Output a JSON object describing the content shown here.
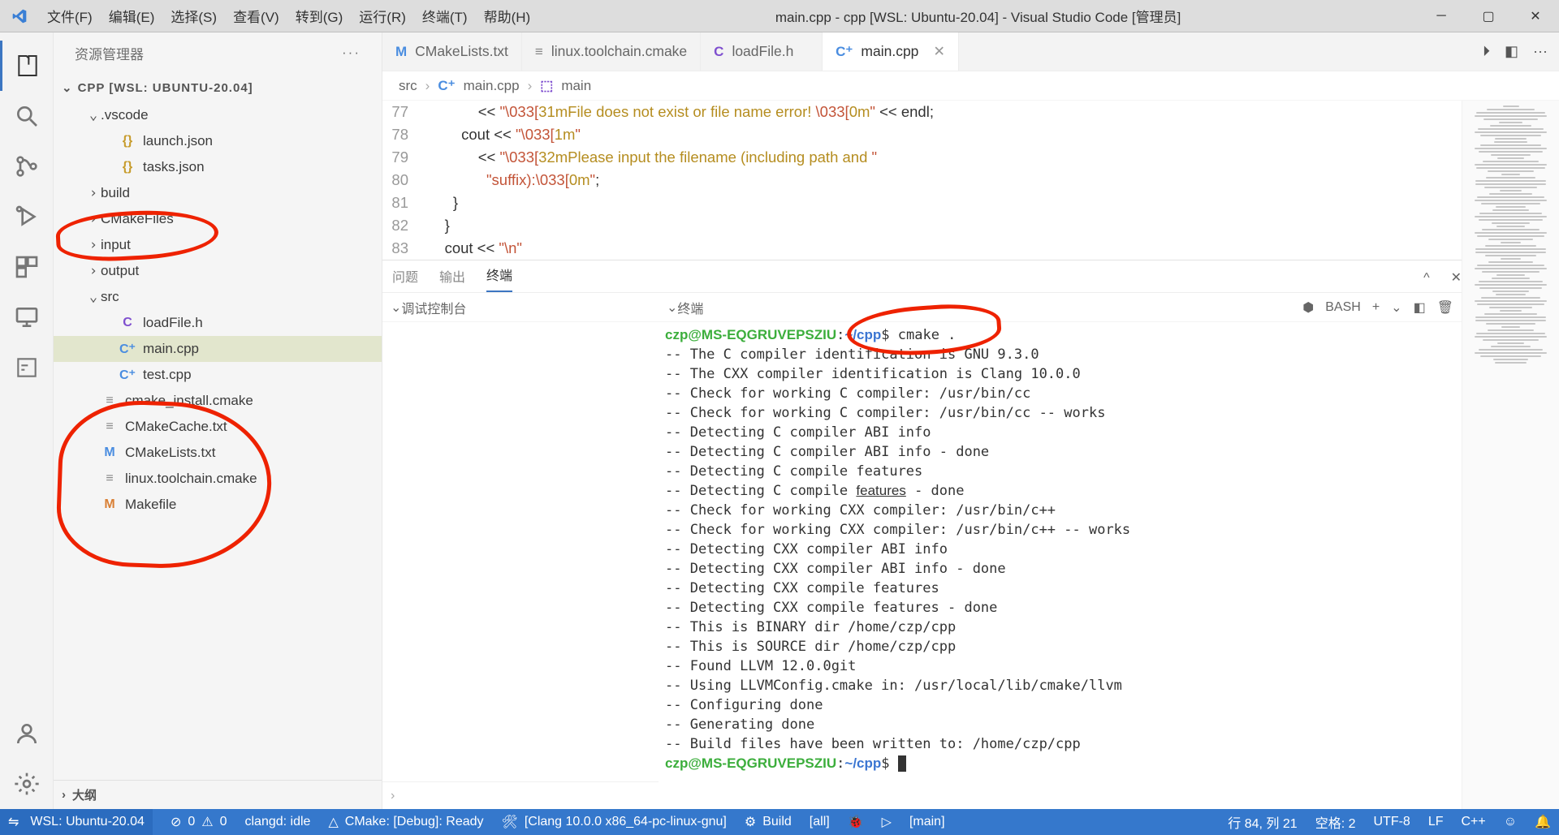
{
  "window": {
    "title": "main.cpp - cpp [WSL: Ubuntu-20.04] - Visual Studio Code [管理员]",
    "menus": [
      "文件(F)",
      "编辑(E)",
      "选择(S)",
      "查看(V)",
      "转到(G)",
      "运行(R)",
      "终端(T)",
      "帮助(H)"
    ]
  },
  "sidebar": {
    "title": "资源管理器",
    "folder_label": "CPP [WSL: UBUNTU-20.04]",
    "tree": [
      {
        "indent": 1,
        "kind": "folder-open",
        "label": ".vscode"
      },
      {
        "indent": 2,
        "kind": "file",
        "icon": "{}",
        "iconcls": "fi-yellow",
        "label": "launch.json"
      },
      {
        "indent": 2,
        "kind": "file",
        "icon": "{}",
        "iconcls": "fi-yellow",
        "label": "tasks.json"
      },
      {
        "indent": 1,
        "kind": "folder-closed",
        "label": "build"
      },
      {
        "indent": 1,
        "kind": "folder-closed",
        "label": "CMakeFiles"
      },
      {
        "indent": 1,
        "kind": "folder-closed",
        "label": "input"
      },
      {
        "indent": 1,
        "kind": "folder-closed",
        "label": "output"
      },
      {
        "indent": 1,
        "kind": "folder-open",
        "label": "src"
      },
      {
        "indent": 2,
        "kind": "file",
        "icon": "C",
        "iconcls": "fi-purple",
        "label": "loadFile.h"
      },
      {
        "indent": 2,
        "kind": "file",
        "icon": "C⁺",
        "iconcls": "fi-blue",
        "label": "main.cpp",
        "selected": true
      },
      {
        "indent": 2,
        "kind": "file",
        "icon": "C⁺",
        "iconcls": "fi-blue",
        "label": "test.cpp"
      },
      {
        "indent": 1,
        "kind": "file",
        "icon": "≡",
        "iconcls": "fi-gray",
        "label": "cmake_install.cmake"
      },
      {
        "indent": 1,
        "kind": "file",
        "icon": "≡",
        "iconcls": "fi-gray",
        "label": "CMakeCache.txt"
      },
      {
        "indent": 1,
        "kind": "file",
        "icon": "M",
        "iconcls": "fi-blue",
        "label": "CMakeLists.txt"
      },
      {
        "indent": 1,
        "kind": "file",
        "icon": "≡",
        "iconcls": "fi-gray",
        "label": "linux.toolchain.cmake"
      },
      {
        "indent": 1,
        "kind": "file",
        "icon": "M",
        "iconcls": "fi-orange",
        "label": "Makefile"
      }
    ],
    "outline": "大纲"
  },
  "tabs": [
    {
      "icon": "M",
      "iconcls": "fi-blue",
      "label": "CMakeLists.txt"
    },
    {
      "icon": "≡",
      "iconcls": "fi-gray",
      "label": "linux.toolchain.cmake"
    },
    {
      "icon": "C",
      "iconcls": "fi-purple",
      "label": "loadFile.h"
    },
    {
      "icon": "C⁺",
      "iconcls": "fi-blue",
      "label": "main.cpp",
      "active": true,
      "close": true
    }
  ],
  "breadcrumbs": {
    "parts": [
      {
        "label": "src"
      },
      {
        "icon": "C⁺",
        "iconcls": "fi-blue",
        "label": "main.cpp"
      },
      {
        "icon": "⬚",
        "iconcls": "fi-purple",
        "label": "main"
      }
    ]
  },
  "code": [
    {
      "n": 77,
      "pre": "            ",
      "segs": [
        {
          "t": "<< ",
          "c": ""
        },
        {
          "t": "\"\\033[",
          "c": "k-str"
        },
        {
          "t": "31mFile does not exist or file name error!",
          "c": "k-esc"
        },
        {
          "t": " \\033[",
          "c": "k-str"
        },
        {
          "t": "0m",
          "c": "k-esc"
        },
        {
          "t": "\"",
          "c": "k-str"
        },
        {
          "t": " << endl;",
          "c": ""
        }
      ]
    },
    {
      "n": 78,
      "pre": "        ",
      "segs": [
        {
          "t": "cout << ",
          "c": ""
        },
        {
          "t": "\"\\033[",
          "c": "k-str"
        },
        {
          "t": "1m",
          "c": "k-esc"
        },
        {
          "t": "\"",
          "c": "k-str"
        }
      ]
    },
    {
      "n": 79,
      "pre": "            ",
      "segs": [
        {
          "t": "<< ",
          "c": ""
        },
        {
          "t": "\"\\033[",
          "c": "k-str"
        },
        {
          "t": "32mPlease input the filename (including path and ",
          "c": "k-esc"
        },
        {
          "t": "\"",
          "c": "k-str"
        }
      ]
    },
    {
      "n": 80,
      "pre": "              ",
      "segs": [
        {
          "t": "\"suffix):",
          "c": "k-str"
        },
        {
          "t": "\\033[",
          "c": "k-str"
        },
        {
          "t": "0m",
          "c": "k-esc"
        },
        {
          "t": "\"",
          "c": "k-str"
        },
        {
          "t": ";",
          "c": ""
        }
      ]
    },
    {
      "n": 81,
      "pre": "      ",
      "segs": [
        {
          "t": "}",
          "c": ""
        }
      ]
    },
    {
      "n": 82,
      "pre": "    ",
      "segs": [
        {
          "t": "}",
          "c": ""
        }
      ]
    },
    {
      "n": 83,
      "pre": "    ",
      "segs": [
        {
          "t": "cout << ",
          "c": ""
        },
        {
          "t": "\"\\n\"",
          "c": "k-str"
        }
      ]
    }
  ],
  "panel": {
    "tabs": [
      "问题",
      "输出",
      "终端"
    ],
    "active_tab": 2,
    "debug_console": "调试控制台",
    "terminal_label": "终端",
    "shell_kind": "BASH",
    "prompt_user": "czp@MS-EQGRUVEPSZIU",
    "prompt_path": "~/cpp",
    "first_cmd": "cmake .",
    "lines": [
      "-- The C compiler identification is GNU 9.3.0",
      "-- The CXX compiler identification is Clang 10.0.0",
      "-- Check for working C compiler: /usr/bin/cc",
      "-- Check for working C compiler: /usr/bin/cc -- works",
      "-- Detecting C compiler ABI info",
      "-- Detecting C compiler ABI info - done",
      "-- Detecting C compile features",
      "-- Detecting C compile features - done",
      "-- Check for working CXX compiler: /usr/bin/c++",
      "-- Check for working CXX compiler: /usr/bin/c++ -- works",
      "-- Detecting CXX compiler ABI info",
      "-- Detecting CXX compiler ABI info - done",
      "-- Detecting CXX compile features",
      "-- Detecting CXX compile features - done",
      "-- This is BINARY dir /home/czp/cpp",
      "-- This is SOURCE dir /home/czp/cpp",
      "-- Found LLVM 12.0.0git",
      "-- Using LLVMConfig.cmake in: /usr/local/lib/cmake/llvm",
      "-- Configuring done",
      "-- Generating done",
      "-- Build files have been written to: /home/czp/cpp"
    ],
    "features_underline_idx": 7
  },
  "status": {
    "remote": "WSL: Ubuntu-20.04",
    "errors": "0",
    "warnings": "0",
    "clangd": "clangd: idle",
    "cmake": "CMake: [Debug]: Ready",
    "kit": "[Clang 10.0.0 x86_64-pc-linux-gnu]",
    "build": "Build",
    "target": "[all]",
    "branch": "[main]",
    "linecol": "行 84, 列 21",
    "spaces": "空格: 2",
    "encoding": "UTF-8",
    "eol": "LF",
    "lang": "C++",
    "bell": "🔔"
  }
}
